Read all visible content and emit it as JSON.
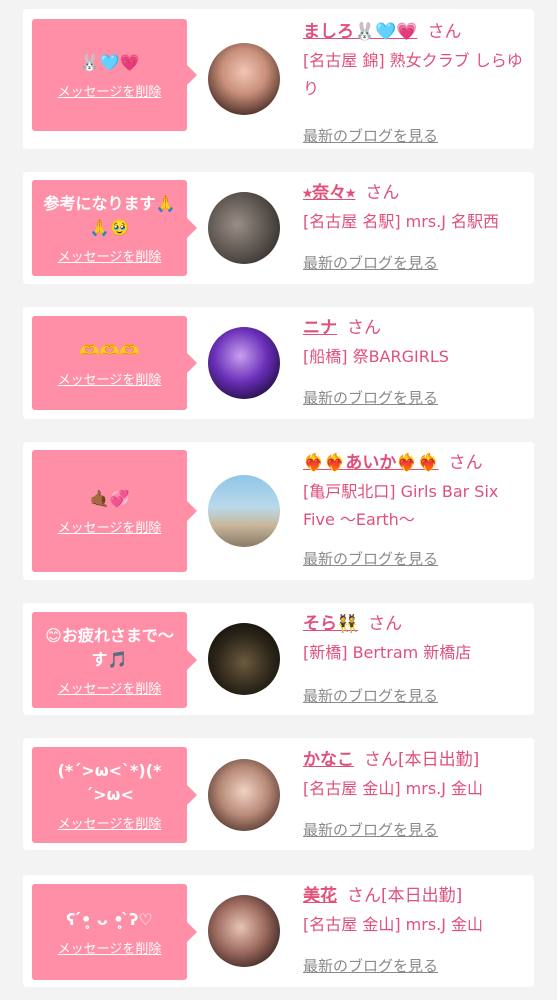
{
  "entries": [
    {
      "message": "🐰🩵💗",
      "delete_label": "メッセージを削除",
      "name": "ましろ🐰🩵💗",
      "san": "さん",
      "shop": "[名古屋 錦] 熟女クラブ しらゆり",
      "blog_label": "最新のブログを見る"
    },
    {
      "message": "参考になります🙏🙏🥹",
      "delete_label": "メッセージを削除",
      "name": "⭑奈々⭑",
      "san": "さん",
      "shop": "[名古屋 名駅] mrs.J 名駅西",
      "blog_label": "最新のブログを見る"
    },
    {
      "message": "🫶🫶🫶",
      "delete_label": "メッセージを削除",
      "name": "ニナ",
      "san": "さん",
      "shop": "[船橋] 祭BARGIRLS",
      "blog_label": "最新のブログを見る"
    },
    {
      "message": "🤙🏾💞",
      "delete_label": "メッセージを削除",
      "name": "❤️‍🔥❤️‍🔥あいか❤️‍🔥❤️‍🔥",
      "san": "さん",
      "shop": "[亀戸駅北口] Girls Bar Six Five 〜Earth〜",
      "blog_label": "最新のブログを見る"
    },
    {
      "message": "😊お疲れさまで〜す🎵",
      "delete_label": "メッセージを削除",
      "name": "そら👯",
      "san": "さん",
      "shop": "[新橋] Bertram 新橋店",
      "blog_label": "最新のブログを見る"
    },
    {
      "message": "(*´>ω<`*)(*´>ω<",
      "delete_label": "メッセージを削除",
      "name": "かなこ",
      "san": "さん[本日出勤]",
      "shop": "[名古屋 金山] mrs.J 金山",
      "blog_label": "最新のブログを見る"
    },
    {
      "message": "ʕ ́•̥ ᴗ •̥ ̀ʔ♡",
      "delete_label": "メッセージを削除",
      "name": "美花",
      "san": "さん[本日出勤]",
      "shop": "[名古屋 金山] mrs.J 金山",
      "blog_label": "最新のブログを見る"
    }
  ],
  "colors": {
    "accent": "#e0507a",
    "bubble": "#ff8fa6",
    "background": "#f3f3f3",
    "card": "#ffffff",
    "link_gray": "#8a8a8a"
  }
}
